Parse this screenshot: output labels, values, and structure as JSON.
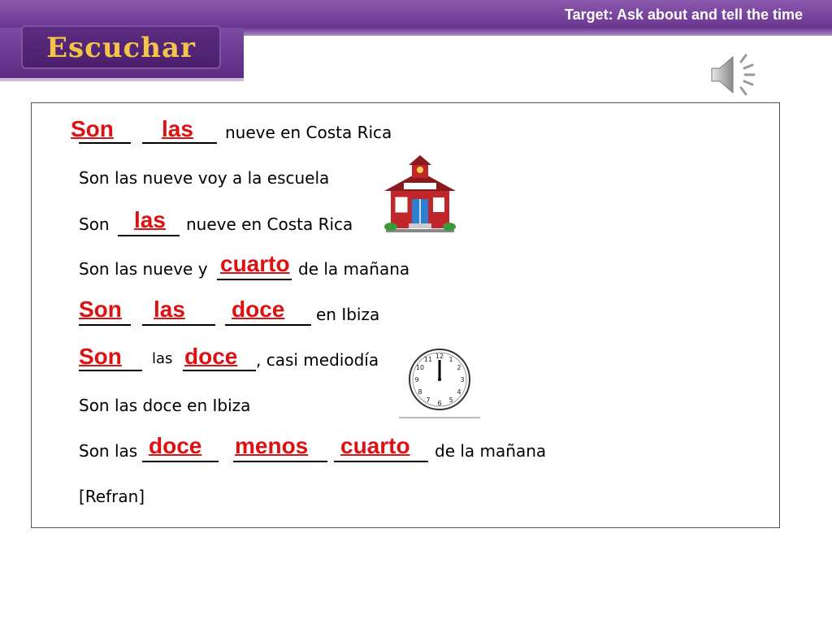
{
  "header": {
    "target": "Target:  Ask about and tell the time",
    "title": "Escuchar"
  },
  "lines": [
    {
      "text": "nueve en Costa Rica"
    },
    {
      "text": "Son las nueve voy a la escuela"
    },
    {
      "prefix": "Son",
      "suffix": "nueve en Costa Rica"
    },
    {
      "prefix": "Son las nueve y",
      "suffix": "de la mañana"
    },
    {
      "suffix": "en Ibiza"
    },
    {
      "mid": "las",
      "suffix": ", casi mediodía"
    },
    {
      "text": "Son las doce en Ibiza"
    },
    {
      "prefix": "Son las",
      "suffix": "de la mañana"
    },
    {
      "text": "[Refran]"
    }
  ],
  "answers": {
    "l1a": "Son",
    "l1b": "las",
    "l3": "las",
    "l4": "cuarto",
    "l5a": "Son",
    "l5b": "las",
    "l5c": "doce",
    "l6a": "Son",
    "l6b": "doce",
    "l8a": "doce",
    "l8b": "menos",
    "l8c": "cuarto"
  },
  "icons": {
    "speaker": "speaker-icon",
    "school": "schoolhouse-icon",
    "clock": "clock-icon"
  },
  "colors": {
    "accent_purple": "#6a3590",
    "title_gold": "#f3c34a",
    "answer_red": "#d11111"
  }
}
